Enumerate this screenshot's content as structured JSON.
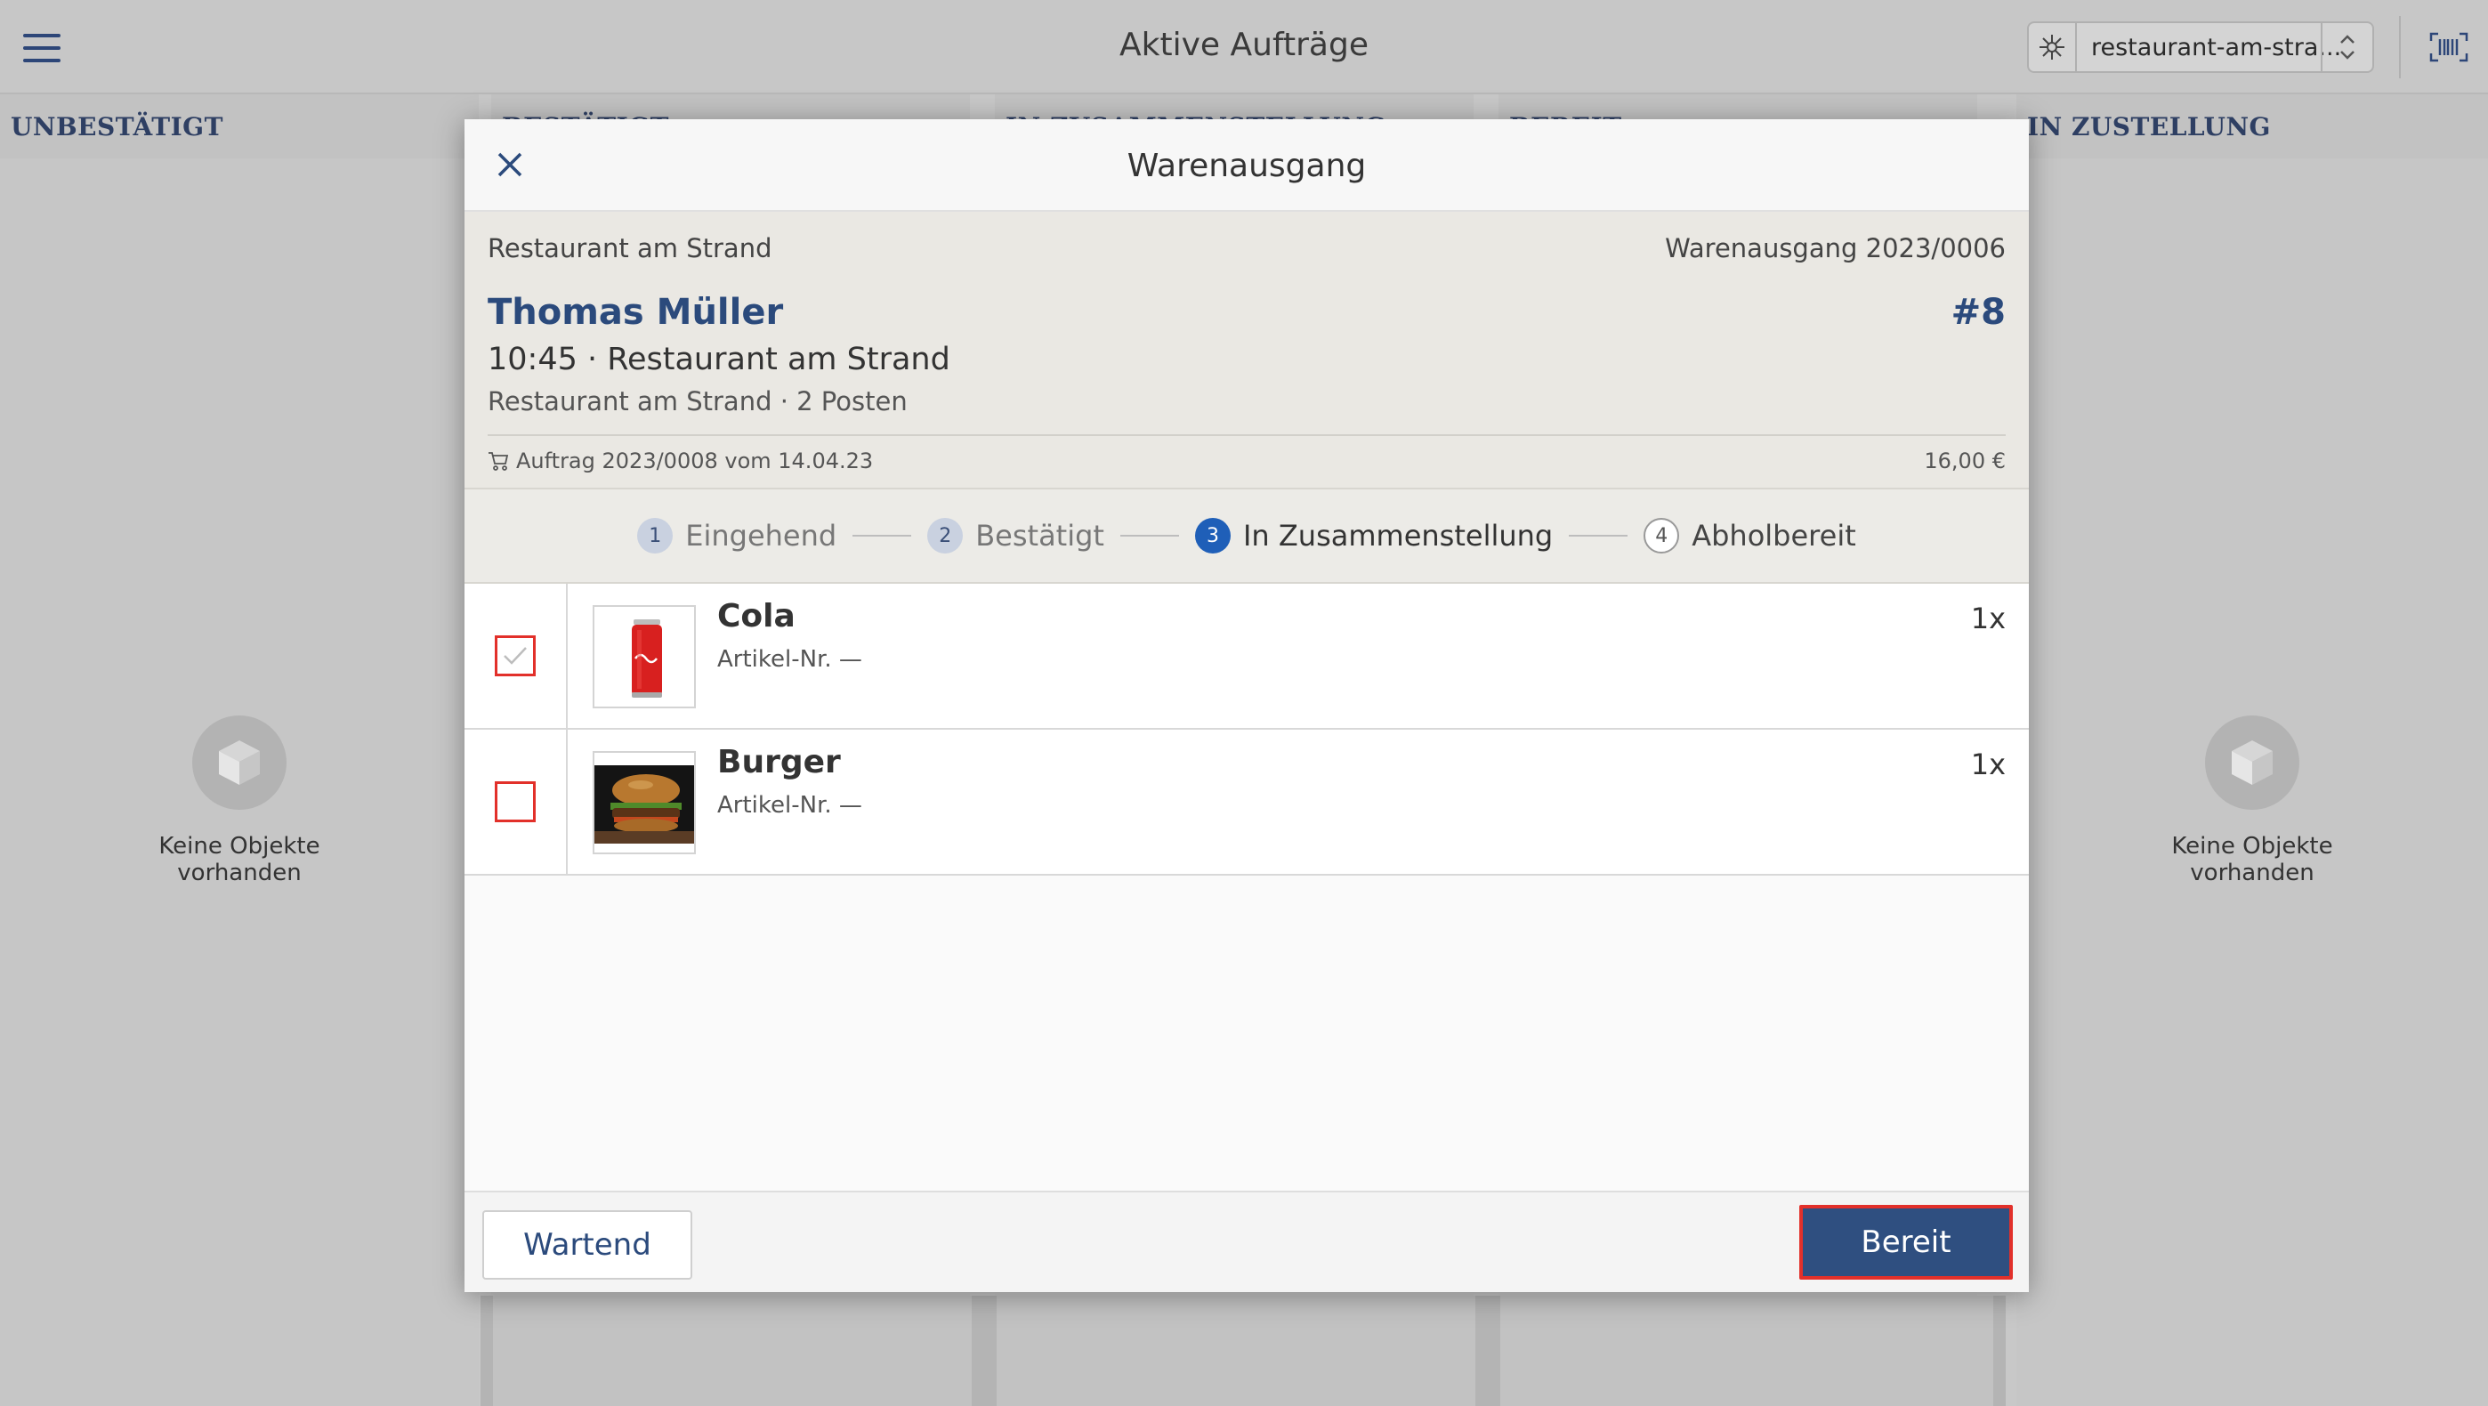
{
  "app": {
    "title": "Aktive Aufträge"
  },
  "store_select": {
    "value": "restaurant-am-stra..."
  },
  "columns": [
    {
      "label": "UNBESTÄTIGT",
      "empty_text": "Keine Objekte vorhanden"
    },
    {
      "label": "BESTÄTIGT"
    },
    {
      "label": "IN ZUSAMMENSTELLUNG"
    },
    {
      "label": "BEREIT"
    },
    {
      "label": "IN ZUSTELLUNG",
      "empty_text": "Keine Objekte vorhanden"
    }
  ],
  "modal": {
    "title": "Warenausgang",
    "store": "Restaurant am Strand",
    "doc_number": "Warenausgang 2023/0006",
    "customer": "Thomas Müller",
    "order_no": "#8",
    "time_line": "10:45 · Restaurant am Strand",
    "sub_line": "Restaurant am Strand · 2 Posten",
    "order_ref": "Auftrag 2023/0008 vom 14.04.23",
    "total": "16,00 €",
    "steps": [
      {
        "num": "1",
        "label": "Eingehend"
      },
      {
        "num": "2",
        "label": "Bestätigt"
      },
      {
        "num": "3",
        "label": "In Zusammenstellung"
      },
      {
        "num": "4",
        "label": "Abholbereit"
      }
    ],
    "active_step": 3,
    "items": [
      {
        "name": "Cola",
        "sku": "Artikel-Nr. —",
        "qty": "1x",
        "checked": true,
        "thumb_icon": "cola-can-icon"
      },
      {
        "name": "Burger",
        "sku": "Artikel-Nr. —",
        "qty": "1x",
        "checked": false,
        "thumb_icon": "burger-icon"
      }
    ],
    "buttons": {
      "wait": "Wartend",
      "ready": "Bereit"
    }
  },
  "colors": {
    "accent": "#2f4f80",
    "highlight": "#e2302a",
    "active_step": "#1f5fb8"
  }
}
